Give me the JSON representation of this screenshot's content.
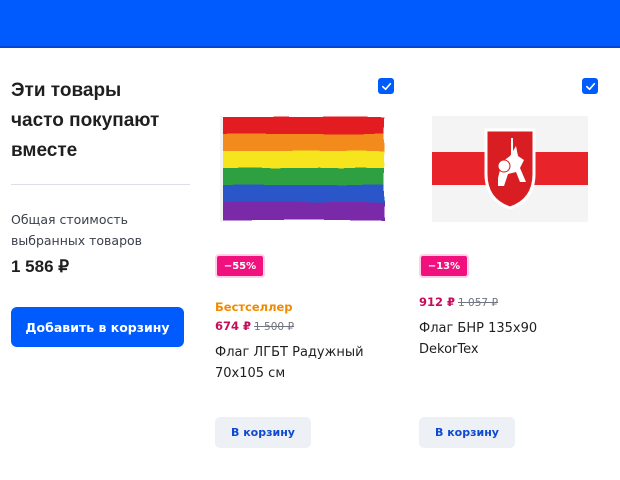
{
  "header": {
    "color": "#005bff"
  },
  "bundle": {
    "title_lines": [
      "Эти товары",
      "часто покупают",
      "вместе"
    ],
    "total_label_lines": [
      "Общая стоимость",
      "выбранных товаров"
    ],
    "total_value": "1 586 ₽",
    "add_to_cart_label": "Добавить в корзину"
  },
  "products": [
    {
      "selected": true,
      "image": "rainbow-flag",
      "discount": "−55%",
      "tag": "Бестселлер",
      "price": "674 ₽",
      "old_price": "1 500 ₽",
      "name_lines": [
        "Флаг ЛГБТ Радужный",
        "70x105 см"
      ],
      "cart_label": "В корзину"
    },
    {
      "selected": true,
      "image": "white-red-white-flag-with-pahonia",
      "discount": "−13%",
      "tag": "",
      "price": "912 ₽",
      "old_price": "1 057 ₽",
      "name_lines": [
        "Флаг БНР 135x90",
        "DekorTex"
      ],
      "cart_label": "В корзину"
    }
  ],
  "colors": {
    "accent": "#005bff",
    "discount": "#f1117e",
    "price": "#c50d5b",
    "bestseller": "#f08a00"
  }
}
